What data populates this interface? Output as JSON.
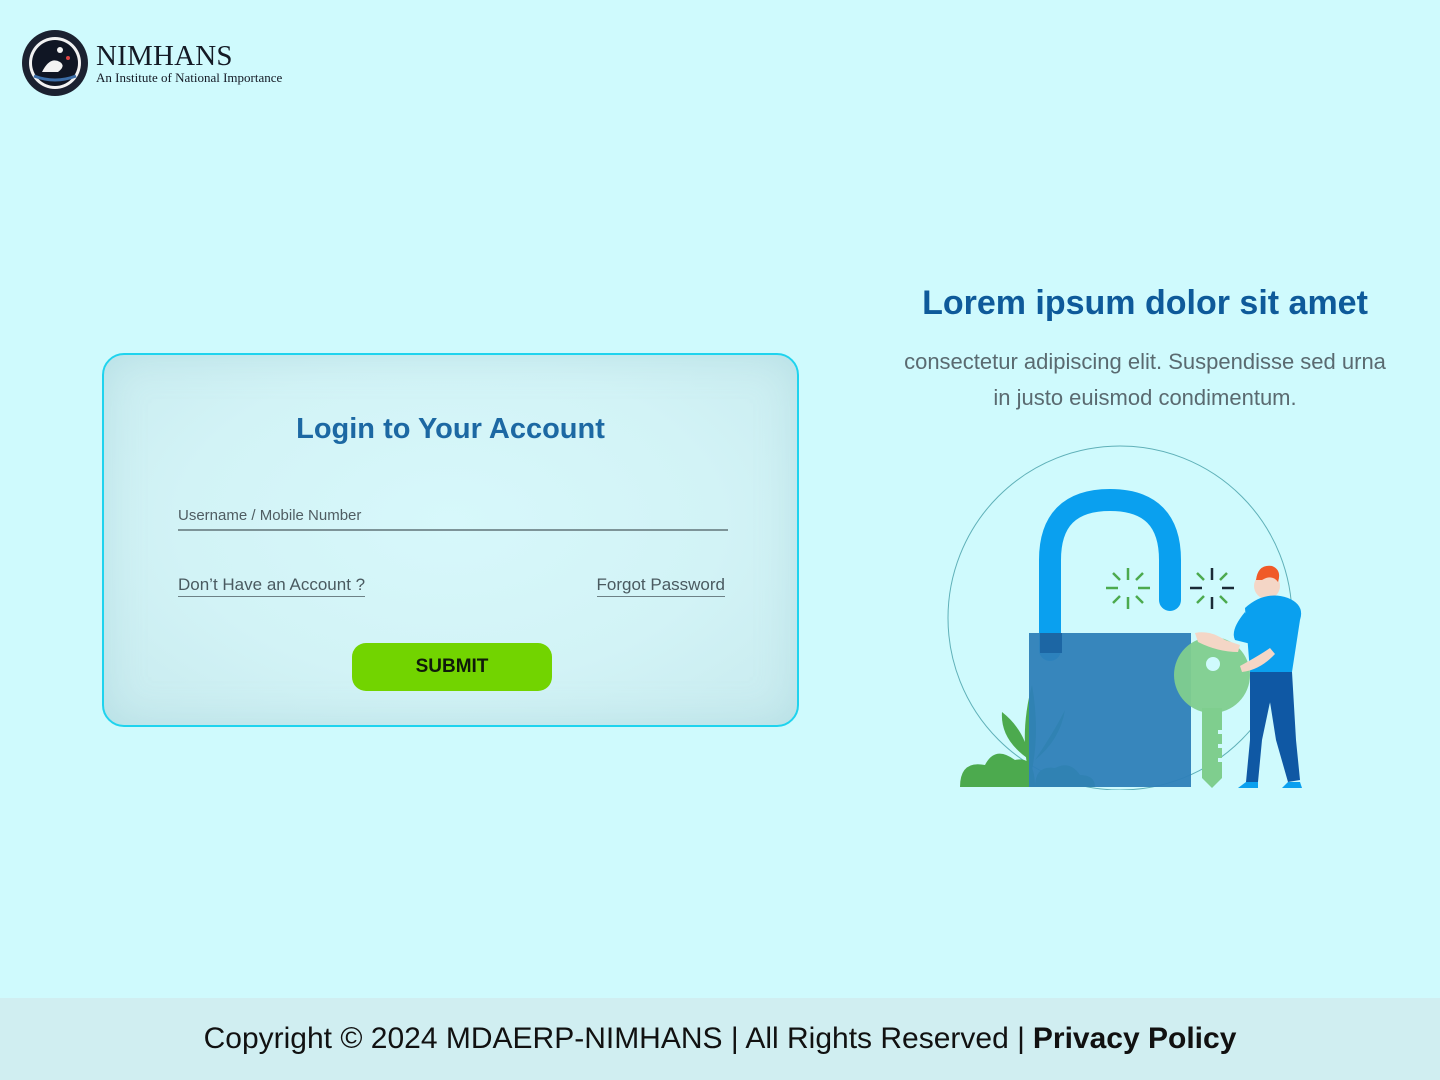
{
  "brand": {
    "name": "NIMHANS",
    "subtitle": "An Institute of National Importance"
  },
  "login": {
    "title": "Login to Your Account",
    "username_placeholder": "Username / Mobile Number",
    "username_value": "",
    "signup_link": "Don’t Have an Account ?",
    "forgot_link": "Forgot Password",
    "submit_label": "SUBMIT"
  },
  "promo": {
    "title": "Lorem ipsum dolor sit amet",
    "text": "consectetur adipiscing elit. Suspendisse sed urna in justo euismod condimentum.",
    "illustration_icon": "unlock-padlock-key-icon"
  },
  "footer": {
    "copyright": "Copyright © 2024 MDAERP-NIMHANS |  All Rights Reserved |",
    "privacy_label": "Privacy Policy"
  },
  "colors": {
    "background": "#cffafd",
    "card_border": "#1fd3ee",
    "title_blue": "#1c68a3",
    "submit_green": "#72d400",
    "promo_blue": "#0e5a9a"
  }
}
